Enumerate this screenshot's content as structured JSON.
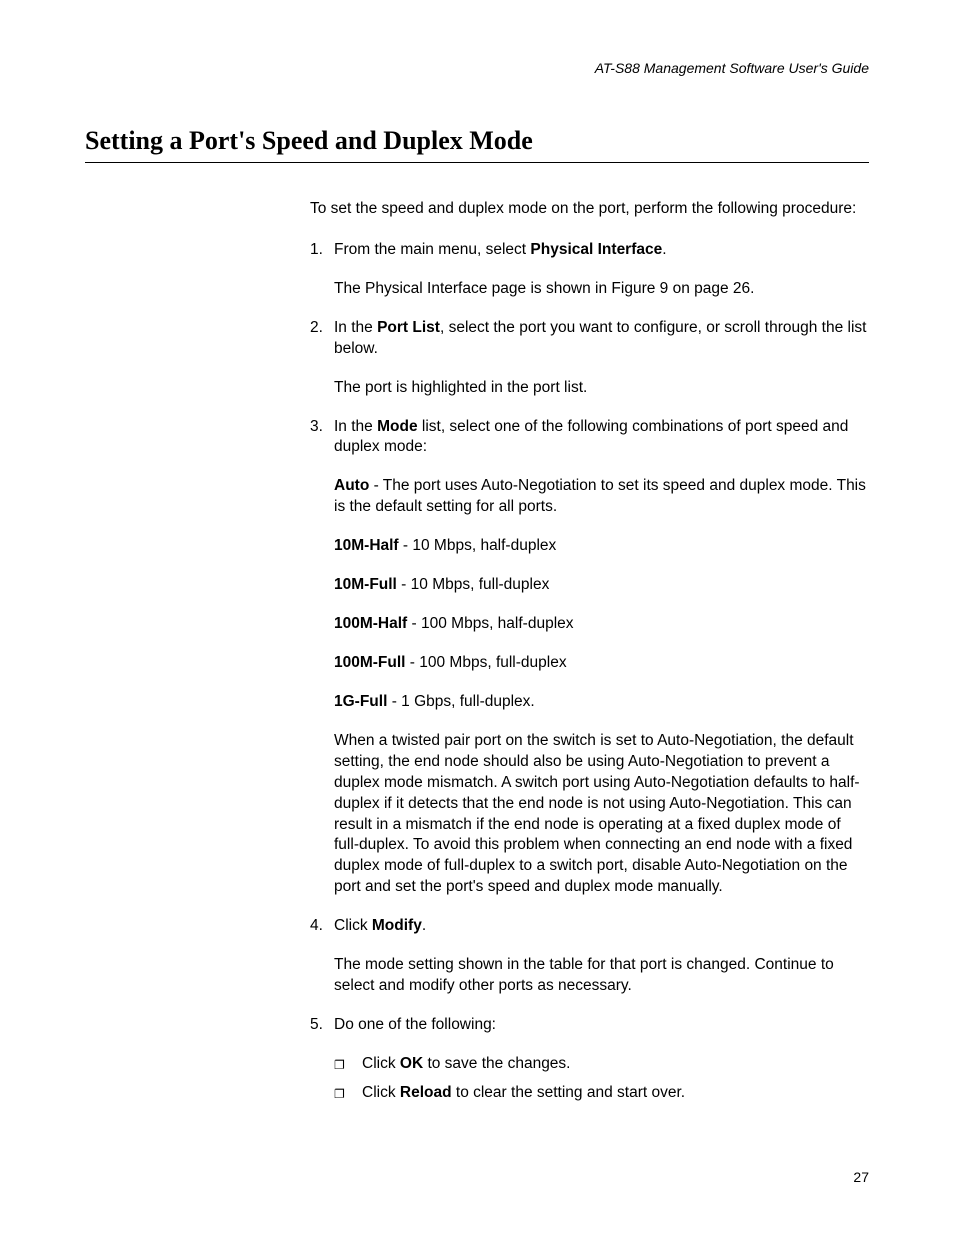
{
  "header": "AT-S88 Management Software User's Guide",
  "sectionTitle": "Setting a Port's Speed and Duplex Mode",
  "intro": "To set the speed and duplex mode on the port, perform the following procedure:",
  "steps": {
    "s1": {
      "num": "1.",
      "textBefore": "From the main menu, select ",
      "bold1": "Physical Interface",
      "textAfter": ".",
      "sub1": "The Physical Interface page is shown in Figure 9 on page 26."
    },
    "s2": {
      "num": "2.",
      "textBefore": "In the ",
      "bold1": "Port List",
      "textAfter": ", select the port you want to configure, or scroll through the list below.",
      "sub1": "The port is highlighted in the port list."
    },
    "s3": {
      "num": "3.",
      "textBefore": "In the ",
      "bold1": "Mode",
      "textAfter": " list, select one of the following combinations of port speed and duplex mode:",
      "modes": {
        "m1b": "Auto",
        "m1t": " - The port uses Auto-Negotiation to set its speed and duplex mode. This is the default setting for all ports.",
        "m2b": "10M-Half",
        "m2t": " - 10 Mbps, half-duplex",
        "m3b": "10M-Full",
        "m3t": " - 10 Mbps, full-duplex",
        "m4b": "100M-Half",
        "m4t": " - 100 Mbps, half-duplex",
        "m5b": "100M-Full",
        "m5t": " - 100 Mbps, full-duplex",
        "m6b": "1G-Full",
        "m6t": " - 1 Gbps, full-duplex."
      },
      "note": "When a twisted pair port on the switch is set to Auto-Negotiation, the default setting, the end node should also be using Auto-Negotiation to prevent a duplex mode mismatch. A switch port using Auto-Negotiation defaults to half-duplex if it detects that the end node is not using Auto-Negotiation. This can result in a mismatch if the end node is operating at a fixed duplex mode of full-duplex. To avoid this problem when connecting an end node with a fixed duplex mode of full-duplex to a switch port, disable Auto-Negotiation on the port and set the port's speed and duplex mode manually."
    },
    "s4": {
      "num": "4.",
      "textBefore": "Click ",
      "bold1": "Modify",
      "textAfter": ".",
      "sub1": "The mode setting shown in the table for that port is changed. Continue to select and modify other ports as necessary."
    },
    "s5": {
      "num": "5.",
      "text": "Do one of the following:",
      "bullets": {
        "b1a": "Click ",
        "b1b": "OK",
        "b1c": " to save the changes.",
        "b2a": "Click ",
        "b2b": "Reload",
        "b2c": " to clear the setting and start over."
      }
    }
  },
  "pageNumber": "27",
  "bulletGlyph": "❐"
}
